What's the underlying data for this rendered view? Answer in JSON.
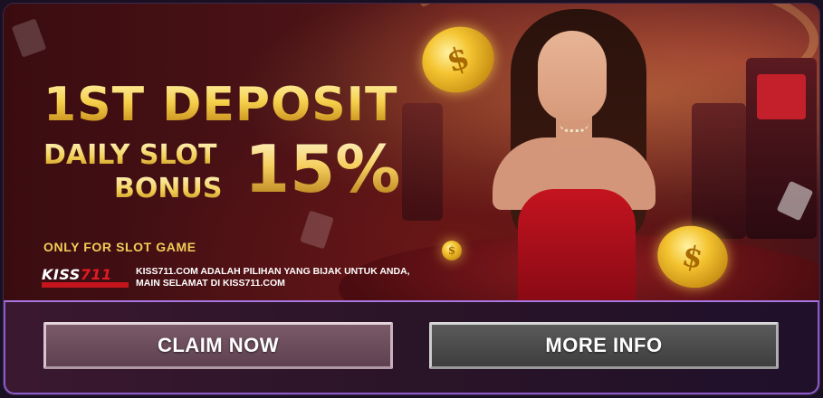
{
  "banner": {
    "headline": "1ST DEPOSIT",
    "sub_line_1": "DAILY SLOT",
    "sub_line_2": "BONUS",
    "percent": "15%",
    "only_for": "ONLY FOR SLOT GAME",
    "logo": {
      "part_a": "KISS",
      "part_b": "711"
    },
    "tagline_1": "KISS711.COM ADALAH PILIHAN YANG BIJAK UNTUK ANDA,",
    "tagline_2": "MAIN SELAMAT DI KISS711.COM",
    "coin_symbol": "$"
  },
  "actions": {
    "claim_label": "CLAIM NOW",
    "more_label": "MORE INFO"
  },
  "colors": {
    "gold": "#f5cf4a",
    "accent_border": "#8c5ac8",
    "logo_red": "#e21b23"
  }
}
